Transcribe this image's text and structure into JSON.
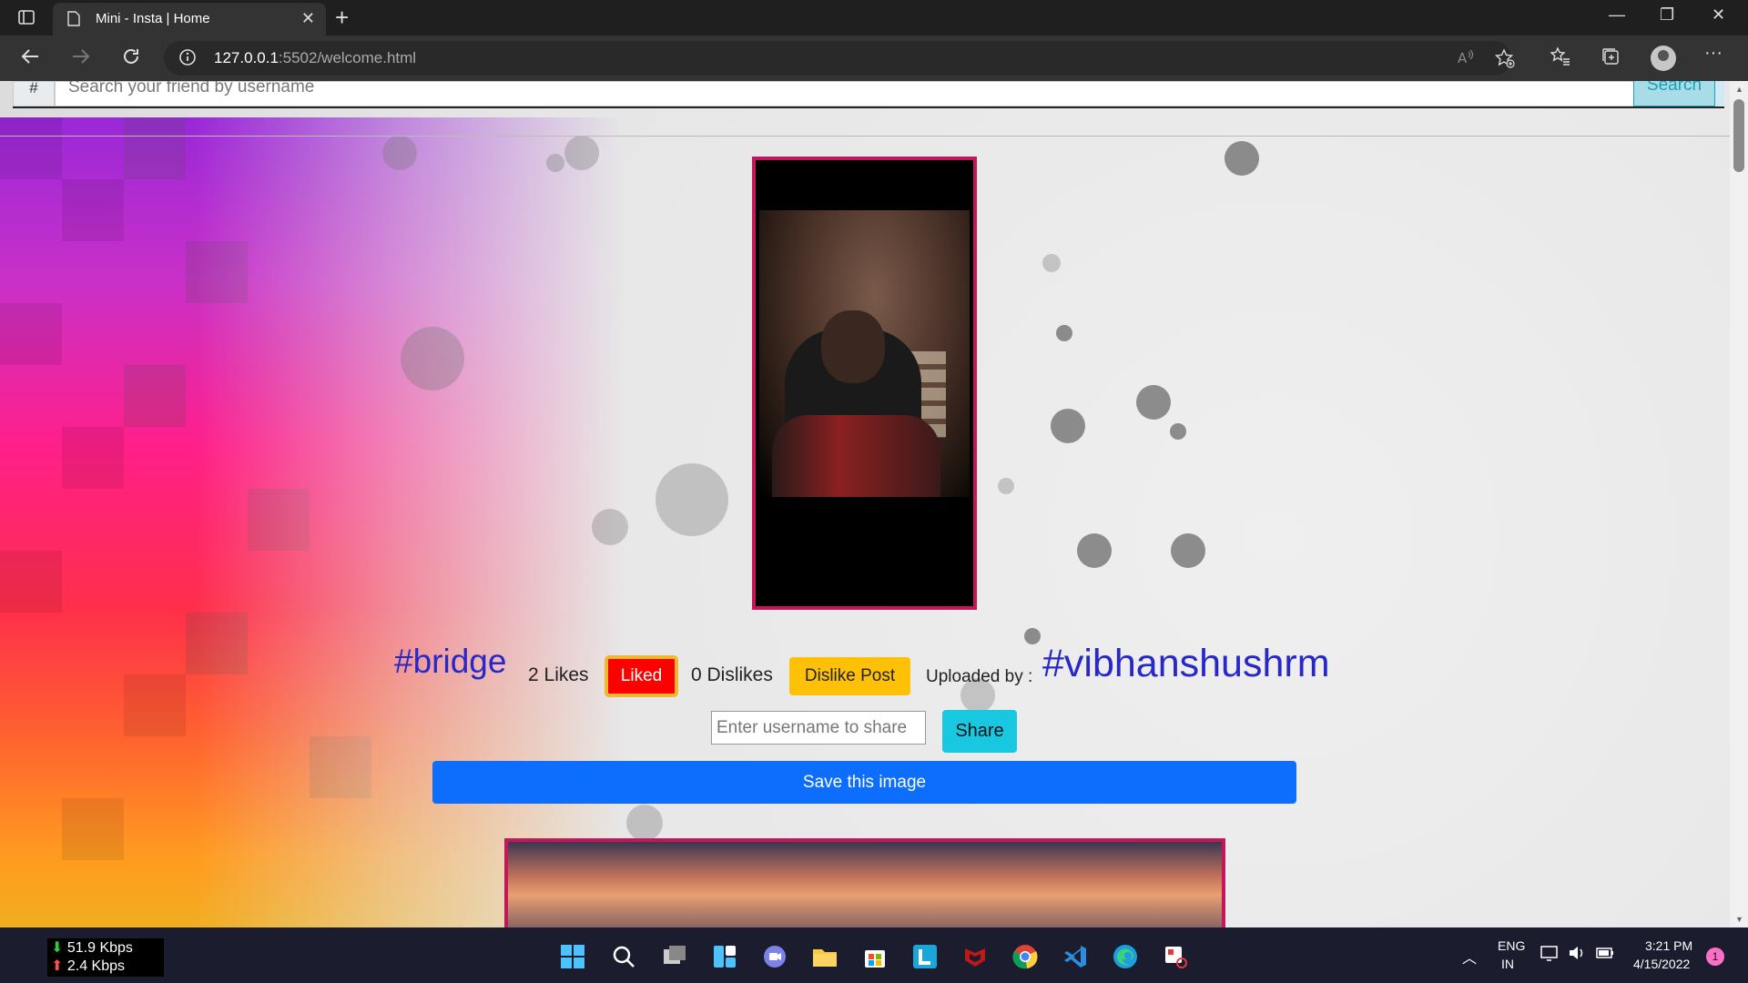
{
  "browser": {
    "tab_title": "Mini - Insta | Home",
    "tab_close": "✕",
    "new_tab": "+",
    "url_host": "127.0.0.1",
    "url_path": ":5502/welcome.html",
    "window_minimize": "—",
    "window_restore": "❐",
    "window_close": "✕"
  },
  "search": {
    "prefix": "#",
    "placeholder": "Search your friend by username",
    "button": "Search"
  },
  "post": {
    "hashtag": "#bridge",
    "likes": "2 Likes",
    "liked_button": "Liked",
    "dislikes": "0 Dislikes",
    "dislike_button": "Dislike Post",
    "uploaded_by_label": "Uploaded by :",
    "uploader": "#vibhanshushrm",
    "share_placeholder": "Enter username to share",
    "share_button": "Share",
    "save_button": "Save this image"
  },
  "taskbar": {
    "download_speed": "51.9 Kbps",
    "upload_speed": "2.4 Kbps",
    "language_top": "ENG",
    "language_bottom": "IN",
    "time": "3:21 PM",
    "date": "4/15/2022",
    "notifications": "1"
  },
  "colors": {
    "accent_tag": "#2828c8",
    "liked": "#ff0000",
    "dislike": "#ffc107",
    "share": "#17c8e0",
    "save": "#0d6efd",
    "post_border": "#c2185b"
  }
}
